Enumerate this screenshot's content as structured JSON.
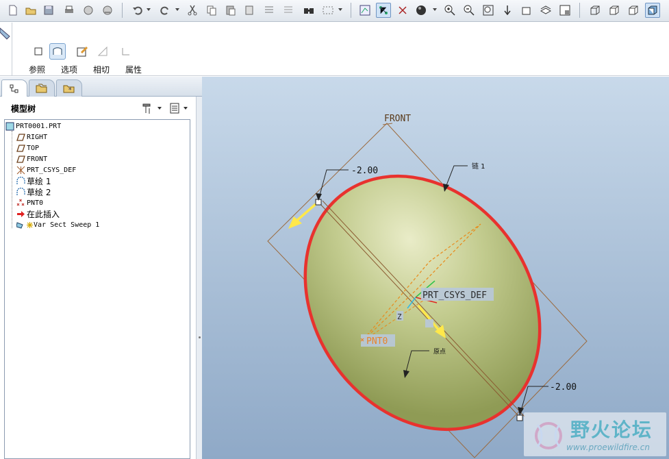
{
  "dashboard": {
    "tabs": [
      {
        "label": "参照",
        "icon": "reference-icon"
      },
      {
        "label": "选项",
        "icon": "options-icon"
      },
      {
        "label": "相切",
        "icon": "tangency-icon"
      },
      {
        "label": "属性",
        "icon": "properties-icon"
      }
    ]
  },
  "model_tree": {
    "title": "模型树",
    "items": [
      {
        "label": "PRT0001.PRT",
        "icon": "part-icon"
      },
      {
        "label": "RIGHT",
        "icon": "datum-plane-icon"
      },
      {
        "label": "TOP",
        "icon": "datum-plane-icon"
      },
      {
        "label": "FRONT",
        "icon": "datum-plane-icon"
      },
      {
        "label": "PRT_CSYS_DEF",
        "icon": "csys-icon"
      },
      {
        "label": "草绘 1",
        "icon": "sketch-icon"
      },
      {
        "label": "草绘 2",
        "icon": "sketch-icon"
      },
      {
        "label": "PNT0",
        "icon": "datum-point-icon"
      },
      {
        "label": "在此插入",
        "icon": "insert-here-arrow-icon"
      },
      {
        "label": "Var Sect Sweep 1",
        "icon": "var-sect-sweep-icon"
      }
    ]
  },
  "viewport": {
    "front_label": "FRONT",
    "dim_top": "-2.00",
    "dim_bottom": "-2.00",
    "chain_label": "链 1",
    "origin_label": "原点",
    "csys_label": "PRT_CSYS_DEF",
    "point_label": "PNT0",
    "axis_z": "Z",
    "colors": {
      "trajectory": "#e8322e",
      "surface": "#bcc98a",
      "datum": "#a0663a"
    }
  },
  "watermark": {
    "title": "野火论坛",
    "url": "www.proewildfire.cn"
  }
}
